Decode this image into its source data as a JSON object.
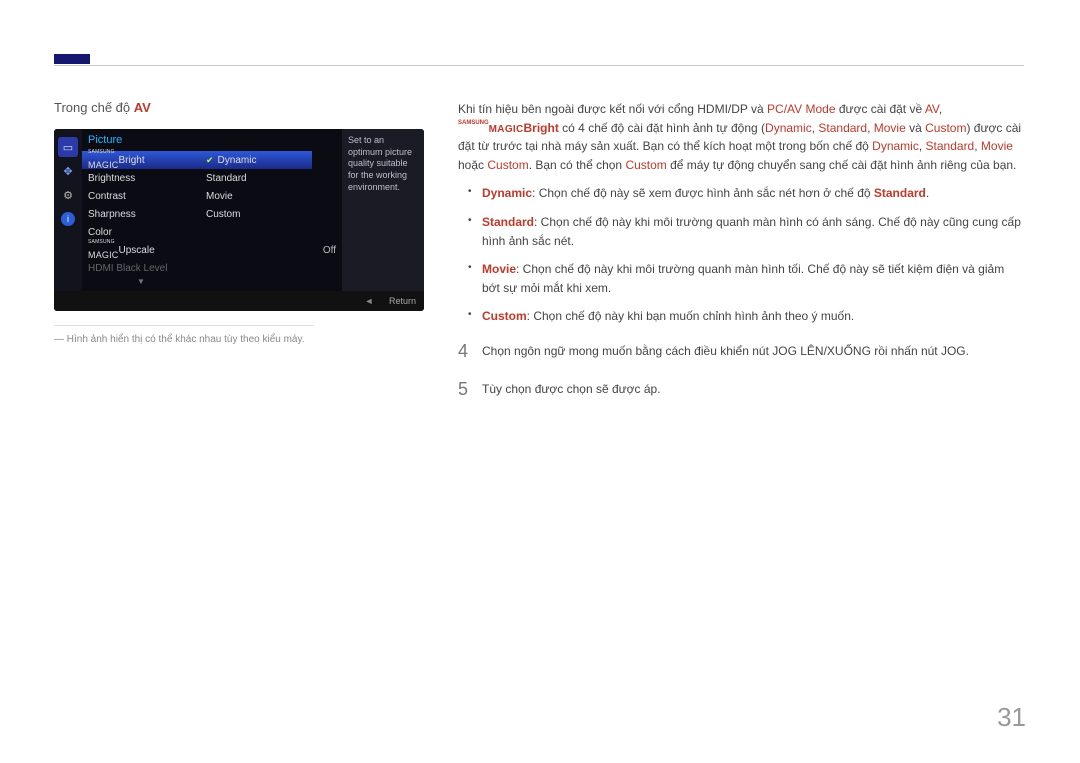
{
  "header": {
    "mode_prefix": "Trong chế độ ",
    "mode": "AV"
  },
  "osd": {
    "title": "Picture",
    "menu": [
      {
        "type": "magic",
        "suffix": "Bright",
        "selected": true
      },
      {
        "label": "Brightness"
      },
      {
        "label": "Contrast"
      },
      {
        "label": "Sharpness"
      },
      {
        "label": "Color"
      },
      {
        "type": "magic",
        "suffix": "Upscale",
        "value": "Off"
      },
      {
        "label": "HDMI Black Level",
        "disabled": true
      }
    ],
    "sub": [
      {
        "label": "Dynamic",
        "selected": true
      },
      {
        "label": "Standard"
      },
      {
        "label": "Movie"
      },
      {
        "label": "Custom"
      }
    ],
    "tip": "Set to an optimum picture quality suitable for the working environment.",
    "return": "Return"
  },
  "footnote": "Hình ảnh hiển thị có thể khác nhau tùy theo kiểu máy.",
  "intro": {
    "t1": "Khi tín hiệu bên ngoài được kết nối với cổng HDMI/DP và ",
    "pcav": "PC/AV Mode",
    "t2": " được cài đặt về ",
    "av": "AV",
    "t3": ", ",
    "bright_suffix": "Bright",
    "t4": " có 4 chế độ cài đặt hình ảnh tự động (",
    "dyn": "Dynamic",
    "c1": ", ",
    "std": "Standard",
    "c2": ", ",
    "mov": "Movie",
    "t5": " và ",
    "cus": "Custom",
    "t6": ") được cài đặt từ trước tại nhà máy sản xuất. Bạn có thể kích hoạt một trong bốn chế độ ",
    "dyn2": "Dynamic",
    "c3": ", ",
    "std2": "Standard",
    "c4": ", ",
    "mov2": "Movie",
    "t7": " hoặc ",
    "cus2": "Custom",
    "t8": ". Bạn có thể chọn ",
    "cus3": "Custom",
    "t9": " để máy tự động chuyển sang chế cài đặt hình ảnh riêng của bạn."
  },
  "bullets": {
    "dyn_k": "Dynamic",
    "dyn_t1": ": Chọn chế độ này sẽ xem được hình ảnh sắc nét hơn ở chế độ ",
    "dyn_std": "Standard",
    "dyn_t2": ".",
    "std_k": "Standard",
    "std_t": ": Chọn chế độ này khi môi trường quanh màn hình có ánh sáng. Chế độ này cũng cung cấp hình ảnh sắc nét.",
    "mov_k": "Movie",
    "mov_t": ": Chọn chế độ này khi môi trường quanh màn hình tối. Chế độ này sẽ tiết kiệm điện và giảm bớt sự mỏi mắt khi xem.",
    "cus_k": "Custom",
    "cus_t": ": Chọn chế độ này khi bạn muốn chỉnh hình ảnh theo ý muốn."
  },
  "steps": {
    "n4": "4",
    "t4": "Chọn ngôn ngữ mong muốn bằng cách điều khiển nút JOG LÊN/XUỐNG rồi nhấn nút JOG.",
    "n5": "5",
    "t5": "Tùy chọn được chọn sẽ được áp."
  },
  "page": "31",
  "magic": {
    "samsung": "SAMSUNG",
    "word": "MAGIC"
  }
}
